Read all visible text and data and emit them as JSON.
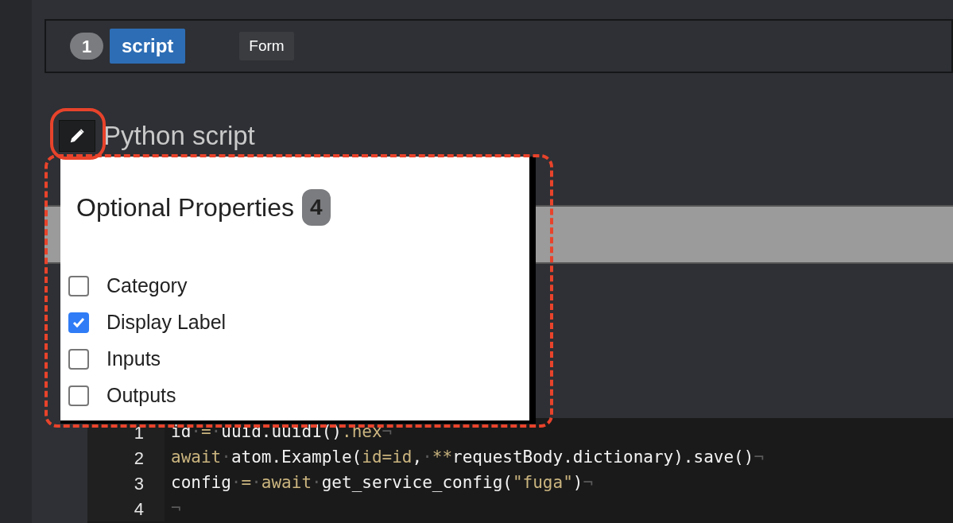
{
  "header": {
    "step": "1",
    "tag": "script",
    "form_button": "Form"
  },
  "title": "Python script",
  "popup": {
    "title": "Optional Properties",
    "count": "4",
    "options": [
      {
        "label": "Category",
        "checked": false
      },
      {
        "label": "Display Label",
        "checked": true
      },
      {
        "label": "Inputs",
        "checked": false
      },
      {
        "label": "Outputs",
        "checked": false
      }
    ]
  },
  "code": {
    "lines": [
      {
        "number": "1",
        "tokens": [
          {
            "text": "id",
            "kind": "plain"
          },
          {
            "text": "·",
            "kind": "mark"
          },
          {
            "text": "=",
            "kind": "accent"
          },
          {
            "text": "·",
            "kind": "mark"
          },
          {
            "text": "uuid.uuid1()",
            "kind": "plain"
          },
          {
            "text": ".hex",
            "kind": "accent"
          },
          {
            "text": "¬",
            "kind": "mark"
          }
        ]
      },
      {
        "number": "2",
        "tokens": [
          {
            "text": "await",
            "kind": "accent"
          },
          {
            "text": "·",
            "kind": "mark"
          },
          {
            "text": "atom.Example(",
            "kind": "plain"
          },
          {
            "text": "id=id",
            "kind": "accent"
          },
          {
            "text": ",",
            "kind": "plain"
          },
          {
            "text": "·",
            "kind": "mark"
          },
          {
            "text": "**",
            "kind": "accent"
          },
          {
            "text": "requestBody.dictionary).save()",
            "kind": "plain"
          },
          {
            "text": "¬",
            "kind": "mark"
          }
        ]
      },
      {
        "number": "3",
        "tokens": [
          {
            "text": "config",
            "kind": "plain"
          },
          {
            "text": "·",
            "kind": "mark"
          },
          {
            "text": "=",
            "kind": "accent"
          },
          {
            "text": "·",
            "kind": "mark"
          },
          {
            "text": "await",
            "kind": "accent"
          },
          {
            "text": "·",
            "kind": "mark"
          },
          {
            "text": "get_service_config(",
            "kind": "plain"
          },
          {
            "text": "\"fuga\"",
            "kind": "accent"
          },
          {
            "text": ")",
            "kind": "plain"
          },
          {
            "text": "¬",
            "kind": "mark"
          }
        ]
      },
      {
        "number": "4",
        "tokens": [
          {
            "text": "¬",
            "kind": "mark"
          }
        ]
      }
    ]
  }
}
